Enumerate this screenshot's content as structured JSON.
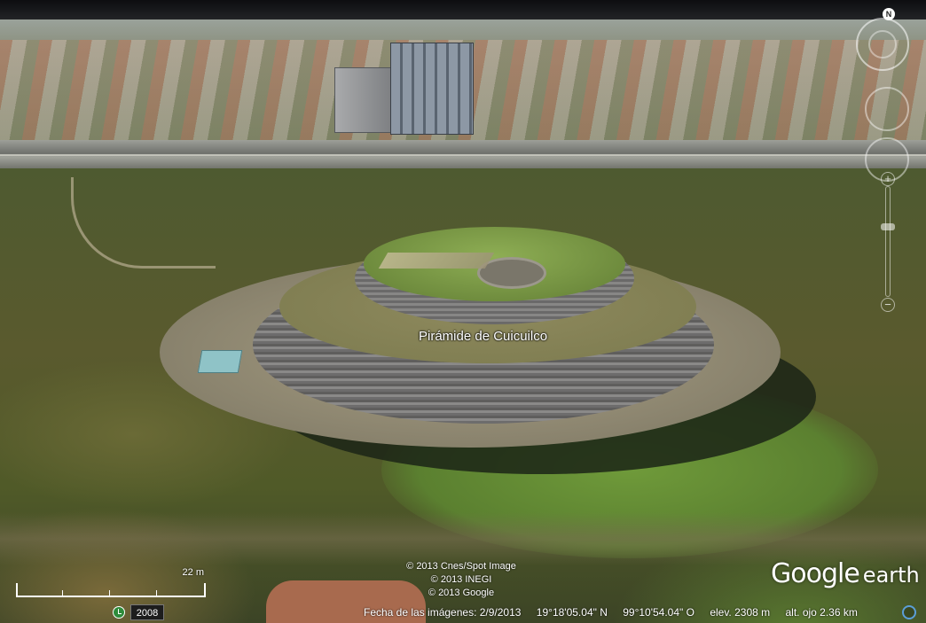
{
  "map": {
    "place_label": "Pirámide de Cuicuilco"
  },
  "credits": [
    "© 2013 Cnes/Spot Image",
    "© 2013 INEGI",
    "© 2013 Google"
  ],
  "logo": {
    "word1": "Google",
    "word2": "earth"
  },
  "scale": {
    "label": "22 m"
  },
  "timebar": {
    "year": "2008",
    "icon": "clock-icon"
  },
  "status": {
    "imagery_date": "Fecha de las imágenes: 2/9/2013",
    "latitude": "19°18'05.04\" N",
    "longitude": "99°10'54.04\" O",
    "elevation": "elev.  2308 m",
    "eye_altitude": "alt. ojo   2.36 km"
  },
  "nav": {
    "north_label": "N",
    "zoom_level": 0.35,
    "icons": [
      "compass-ring-icon",
      "look-joystick-icon",
      "move-joystick-icon",
      "zoom-slider-icon",
      "streaming-indicator-icon"
    ]
  },
  "colors": {
    "label_text": "#ffffff",
    "stream_indicator": "#5b9ed8",
    "timebar_icon": "#2e8b3a"
  }
}
